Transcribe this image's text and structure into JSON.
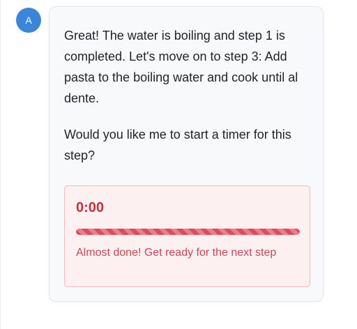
{
  "message": {
    "avatar_initial": "A",
    "paragraphs": [
      "Great! The water is boiling and step 1 is completed. Let's move on to step 3: Add pasta to the boiling water and cook until al dente.",
      "Would you like me to start a timer for this step?"
    ]
  },
  "timer": {
    "value": "0:00",
    "progress_percent": 100,
    "status_message": "Almost done! Get ready for the next step"
  },
  "colors": {
    "avatar": "#3b86d8",
    "timer_accent": "#c4313f",
    "timer_background": "#fdf0f1"
  }
}
